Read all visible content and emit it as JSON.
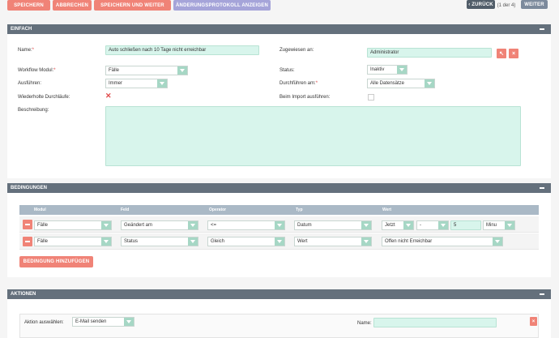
{
  "toolbar": {
    "save": "SPEICHERN",
    "cancel": "ABBRECHEN",
    "save_continue": "SPEICHERN UND WEITER",
    "changelog": "ÄNDERUNGSPROTOKOLL ANZEIGEN",
    "back": "ZURÜCK",
    "pager": "(1 der 4)",
    "next": "WEITER"
  },
  "einfach": {
    "title": "EINFACH",
    "name_label": "Name:",
    "name_value": "Auto schließen nach 10 Tage nicht erreichbar",
    "assigned_label": "Zugewiesen an:",
    "assigned_value": "Administrator",
    "module_label": "Workflow Modul:",
    "module_value": "Fälle",
    "status_label": "Status:",
    "status_value": "Inaktiv",
    "run_label": "Ausführen:",
    "run_value": "Immer",
    "run_on_label": "Durchführen am:",
    "run_on_value": "Alle Datensätze",
    "repeat_label": "Wiederholte Durchläufe:",
    "import_label": "Beim Import ausführen:",
    "desc_label": "Beschreibung:"
  },
  "bedingungen": {
    "title": "BEDINGUNGEN",
    "headers": {
      "modul": "Modul",
      "feld": "Feld",
      "operator": "Operator",
      "typ": "Typ",
      "wert": "Wert"
    },
    "rows": [
      {
        "modul": "Fälle",
        "feld": "Geändert am",
        "operator": "<=",
        "typ": "Datum",
        "w1": "Jetzt",
        "w2": "-",
        "w3": "5",
        "w4": "Minu"
      },
      {
        "modul": "Fälle",
        "feld": "Status",
        "operator": "Gleich",
        "typ": "Wert",
        "wert": "Offen nicht Erreichbar"
      }
    ],
    "add_button": "BEDINGUNG HINZUFÜGEN"
  },
  "aktionen": {
    "title": "AKTIONEN",
    "select_label": "Aktion auswählen:",
    "select_value": "E-Mail senden",
    "name_label": "Name:"
  },
  "colors": {
    "accent": "#f08377",
    "purple": "#a5a4d9",
    "header": "#64707c",
    "field": "#d8f5ec"
  }
}
